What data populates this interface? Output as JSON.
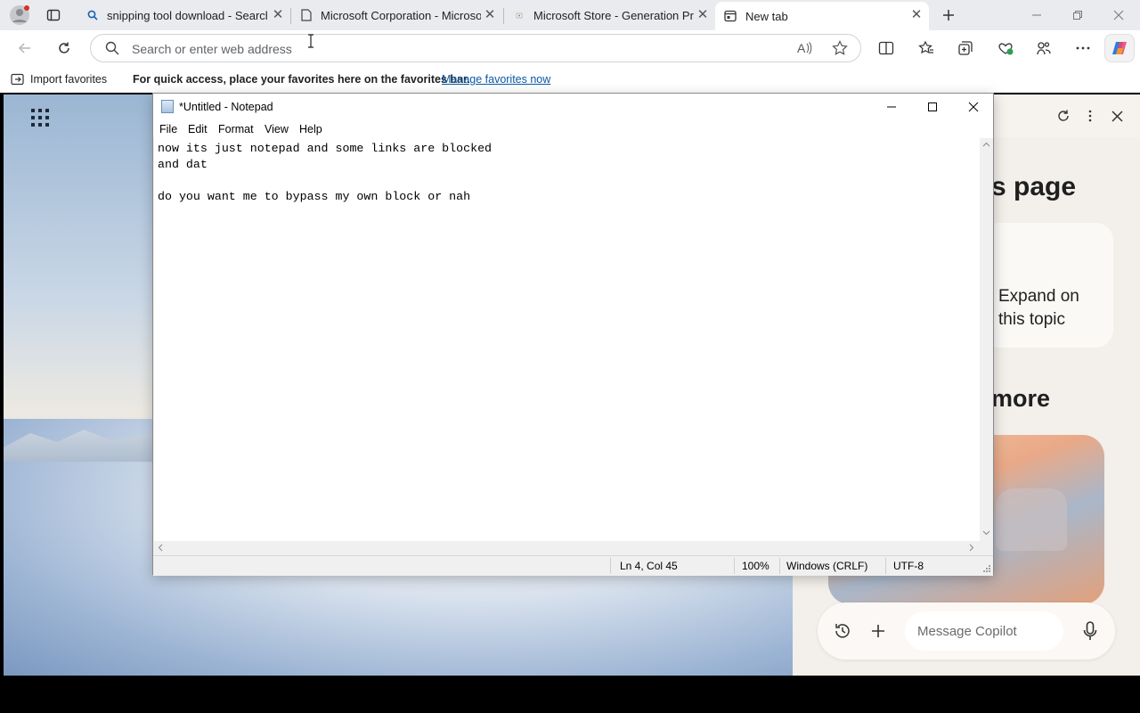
{
  "browser": {
    "tabs": [
      {
        "label": "snipping tool download - Search",
        "icon": "search-icon"
      },
      {
        "label": "Microsoft Corporation - Microsoft",
        "icon": "page-icon"
      },
      {
        "label": "Microsoft Store - Generation Project",
        "icon": "store-icon"
      },
      {
        "label": "New tab",
        "icon": "newtab-icon"
      }
    ],
    "address_placeholder": "Search or enter web address",
    "favorites": {
      "import_label": "Import favorites",
      "hint": "For quick access, place your favorites here on the favorites bar.",
      "manage_link": "Manage favorites now"
    }
  },
  "copilot": {
    "title_fragment": "s page",
    "card_text": "Expand on this topic",
    "section_fragment": "more",
    "message_placeholder": "Message Copilot"
  },
  "notepad": {
    "title": "*Untitled - Notepad",
    "menu": [
      "File",
      "Edit",
      "Format",
      "View",
      "Help"
    ],
    "content": "now its just notepad and some links are blocked\nand dat\n\ndo you want me to bypass my own block or nah",
    "status": {
      "position": "Ln 4, Col 45",
      "zoom": "100%",
      "line_ending": "Windows (CRLF)",
      "encoding": "UTF-8"
    }
  },
  "colors": {
    "accent_link": "#0a58a8",
    "tabstrip_bg": "#e9ebee"
  }
}
